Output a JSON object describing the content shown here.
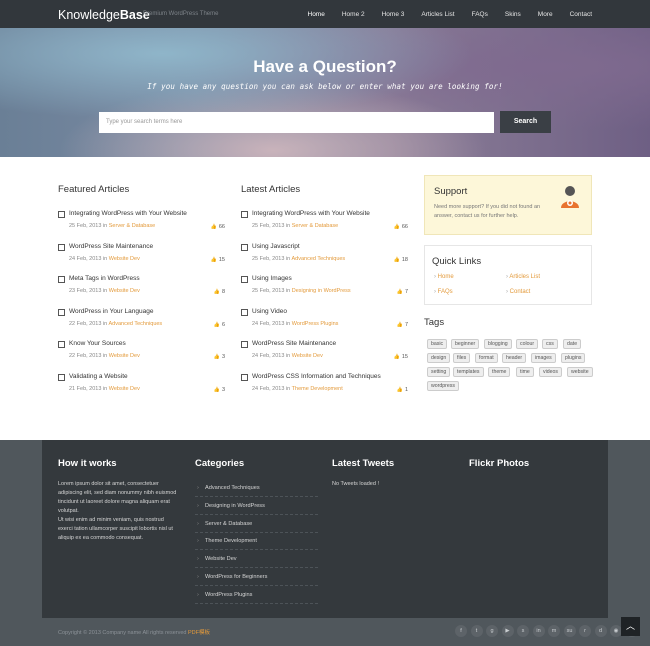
{
  "header": {
    "logo_main": "Knowledge",
    "logo_bold": "Base",
    "tagline": "Premium WordPress Theme",
    "nav": [
      "Home",
      "Home 2",
      "Home 3",
      "Articles List",
      "FAQs",
      "Skins",
      "More",
      "Contact"
    ]
  },
  "hero": {
    "title": "Have a Question?",
    "subtitle": "If you have any question you can ask below or enter what you are looking for!",
    "search_placeholder": "Type your search terms here",
    "search_button": "Search"
  },
  "featured": {
    "title": "Featured Articles",
    "items": [
      {
        "title": "Integrating WordPress with Your Website",
        "date": "25 Feb, 2013",
        "cat": "Server & Database",
        "count": "66"
      },
      {
        "title": "WordPress Site Maintenance",
        "date": "24 Feb, 2013",
        "cat": "Website Dev",
        "count": "15"
      },
      {
        "title": "Meta Tags in WordPress",
        "date": "23 Feb, 2013",
        "cat": "Website Dev",
        "count": "8"
      },
      {
        "title": "WordPress in Your Language",
        "date": "22 Feb, 2013",
        "cat": "Advanced Techniques",
        "count": "6"
      },
      {
        "title": "Know Your Sources",
        "date": "22 Feb, 2013",
        "cat": "Website Dev",
        "count": "3"
      },
      {
        "title": "Validating a Website",
        "date": "21 Feb, 2013",
        "cat": "Website Dev",
        "count": "3"
      }
    ]
  },
  "latest": {
    "title": "Latest Articles",
    "items": [
      {
        "title": "Integrating WordPress with Your Website",
        "date": "25 Feb, 2013",
        "cat": "Server & Database",
        "count": "66"
      },
      {
        "title": "Using Javascript",
        "date": "25 Feb, 2013",
        "cat": "Advanced Techniques",
        "count": "18"
      },
      {
        "title": "Using Images",
        "date": "25 Feb, 2013",
        "cat": "Designing in WordPress",
        "count": "7"
      },
      {
        "title": "Using Video",
        "date": "24 Feb, 2013",
        "cat": "WordPress Plugins",
        "count": "7"
      },
      {
        "title": "WordPress Site Maintenance",
        "date": "24 Feb, 2013",
        "cat": "Website Dev",
        "count": "15"
      },
      {
        "title": "WordPress CSS Information and Techniques",
        "date": "24 Feb, 2013",
        "cat": "Theme Development",
        "count": "1"
      }
    ]
  },
  "meta_in": "in",
  "support": {
    "title": "Support",
    "text": "Need more support? If you did not found an answer, contact us for further help."
  },
  "quick_links": {
    "title": "Quick Links",
    "links": [
      "Home",
      "Articles List",
      "FAQs",
      "Contact"
    ]
  },
  "tags": {
    "title": "Tags",
    "items": [
      "basic",
      "beginner",
      "blogging",
      "colour",
      "css",
      "date",
      "design",
      "files",
      "format",
      "header",
      "images",
      "plugins",
      "setting",
      "templates",
      "theme",
      "time",
      "videos",
      "website",
      "wordpress"
    ]
  },
  "footer": {
    "how_title": "How it works",
    "how_p1": "Lorem ipsum dolor sit amet, consectetuer adipiscing elit, sed diam nonummy nibh euismod tincidunt ut laoreet dolore magna aliquam erat volutpat.",
    "how_p2": "Ut wisi enim ad minim veniam, quis nostrud exerci tation ullamcorper suscipit lobortis nisl ut aliquip ex ea commodo consequat.",
    "cat_title": "Categories",
    "categories": [
      "Advanced Techniques",
      "Designing in WordPress",
      "Server & Database",
      "Theme Development",
      "Website Dev",
      "WordPress for Beginners",
      "WordPress Plugins"
    ],
    "tweets_title": "Latest Tweets",
    "tweets_text": "No Tweets loaded !",
    "flickr_title": "Flickr Photos",
    "copyright": "Copyright © 2013 Company name All rights reserved",
    "copyright_link": "PDF模板"
  },
  "social_icons": [
    "facebook-icon",
    "twitter-icon",
    "google-plus-icon",
    "youtube-icon",
    "skype-icon",
    "linkedin-icon",
    "myspace-icon",
    "stumbleupon-icon",
    "reddit-icon",
    "dribbble-icon",
    "rss-icon",
    "forrst-icon"
  ],
  "colors": {
    "accent": "#e39a3b",
    "header": "#32373c",
    "footer": "#34393d"
  }
}
